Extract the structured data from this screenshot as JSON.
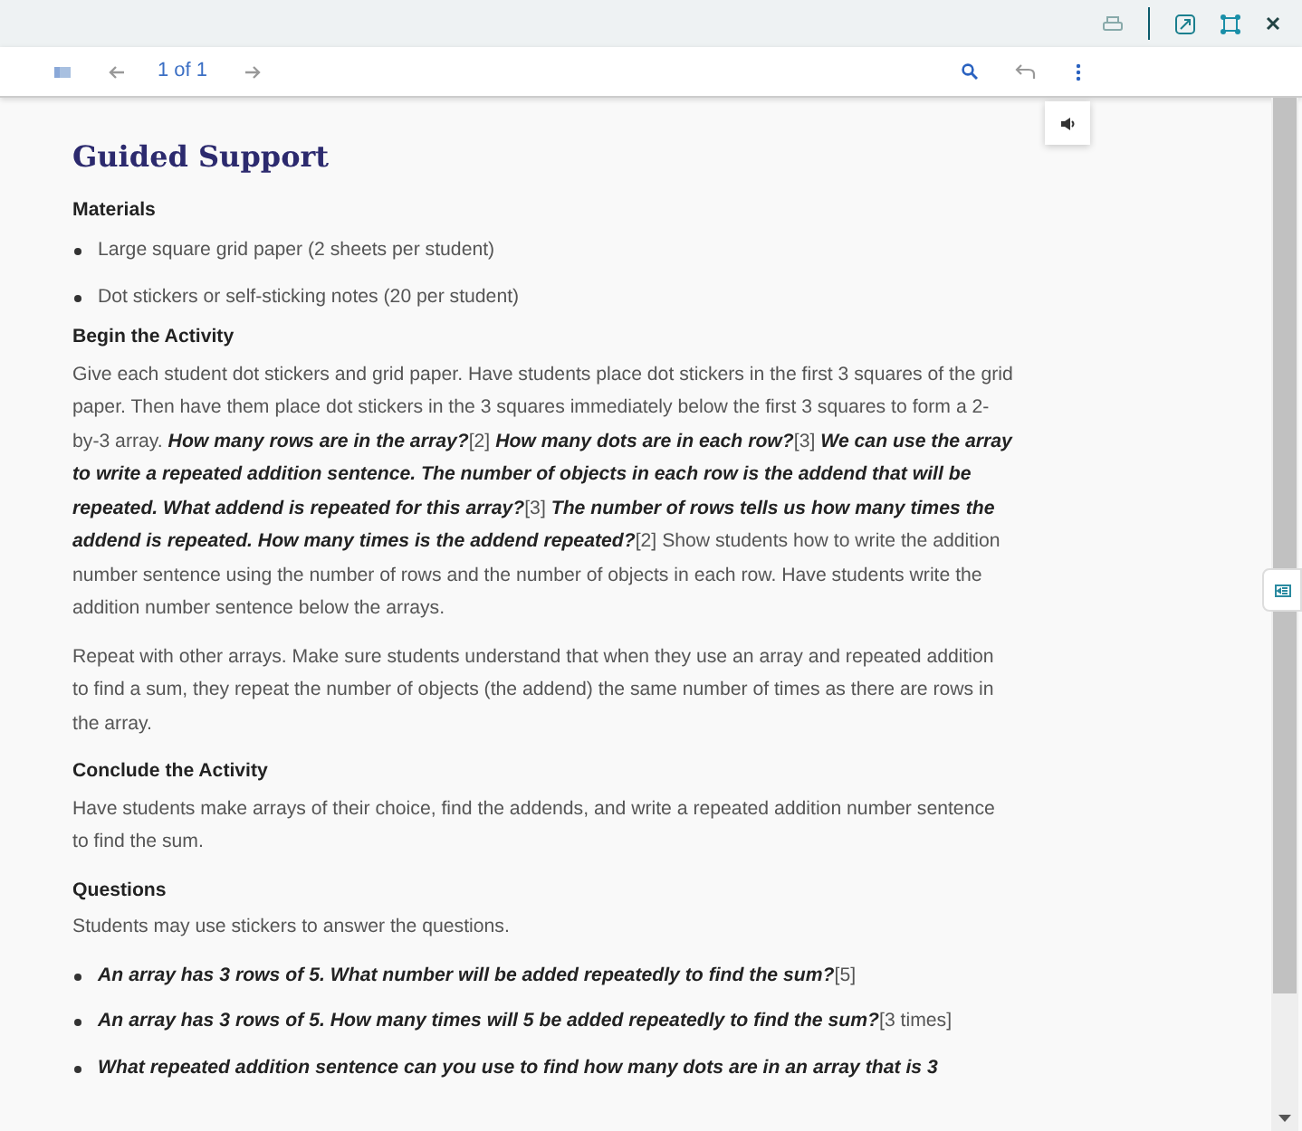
{
  "toolbar": {
    "page_indicator": "1 of 1"
  },
  "title": "Guided Support",
  "sections": [
    {
      "heading": "Materials",
      "blocks": [
        {
          "kind": "bullets",
          "items": [
            "Large square grid paper (2 sheets per student)",
            "Dot stickers or self-sticking notes (20 per student)"
          ]
        }
      ]
    },
    {
      "heading": "Begin the Activity",
      "blocks": [
        {
          "kind": "paragraph",
          "text": "Give each student dot stickers and grid paper. Have students place dot stickers in the first 3 squares of the grid paper. Then have them place dot stickers in the 3 squares immediately below the first 3 squares to form a 2-by-3 array. **How many rows are in the array?**[2] **How many dots are in each row?**[3] **We can use the array to write a repeated addition sentence. The number of objects in each row is the addend that will be repeated. What addend is repeated for this array?**[3] **The number of rows tells us how many times the addend is repeated. How many times is the addend repeated?**[2] Show students how to write the addition number sentence using the number of rows and the number of objects in each row. Have students write the addition number sentence below the arrays."
        },
        {
          "kind": "paragraph",
          "text": "Repeat with other arrays. Make sure students understand that when they use an array and repeated addition to find a sum, they repeat the number of objects (the addend) the same number of times as there are rows in the array."
        }
      ]
    },
    {
      "heading": "Conclude the Activity",
      "blocks": [
        {
          "kind": "paragraph",
          "text": "Have students make arrays of their choice, find the addends, and write a repeated addition number sentence to find the sum."
        }
      ]
    },
    {
      "heading": "Questions",
      "blocks": [
        {
          "kind": "paragraph",
          "text": "Students may use stickers to answer the questions."
        },
        {
          "kind": "bullets",
          "items": [
            "**An array has 3 rows of 5. What number will be added repeatedly to find the sum?**[5]",
            "**An array has 3 rows of 5. How many times will 5 be added repeatedly to find the sum?**[3 times]",
            "**What repeated addition sentence can you use to find how many dots are in an array that is 3**"
          ]
        }
      ]
    }
  ]
}
